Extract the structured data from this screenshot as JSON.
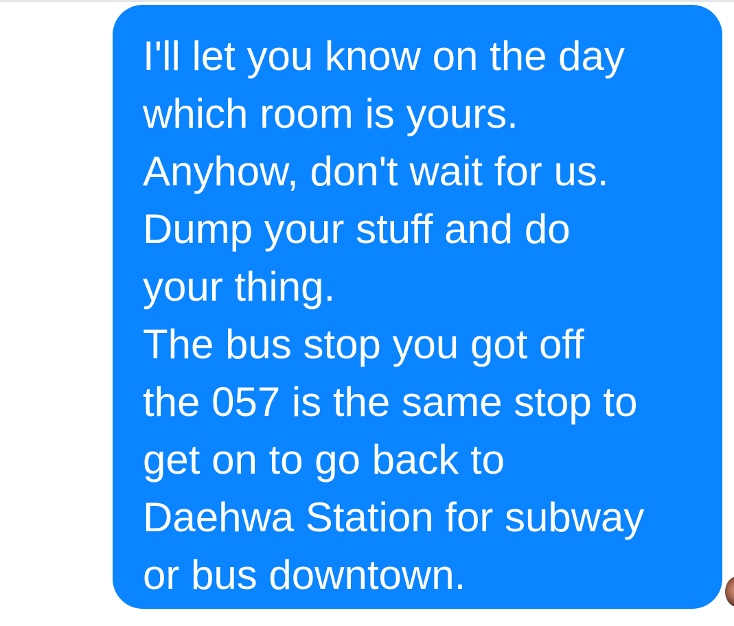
{
  "conversation": {
    "message": {
      "lines": [
        "I'll let you know on the day",
        "which room is yours.",
        "Anyhow, don't wait for us.",
        "Dump your stuff and do",
        "your thing.",
        "The bus stop you got off",
        "the 057 is the same stop to",
        "get on to go back to",
        "Daehwa Station for subway",
        "or bus downtown."
      ]
    },
    "avatar_icon": "contact-avatar",
    "colors": {
      "bubble": "#0a84ff",
      "text": "#ffffff",
      "background": "#ffffff"
    }
  }
}
